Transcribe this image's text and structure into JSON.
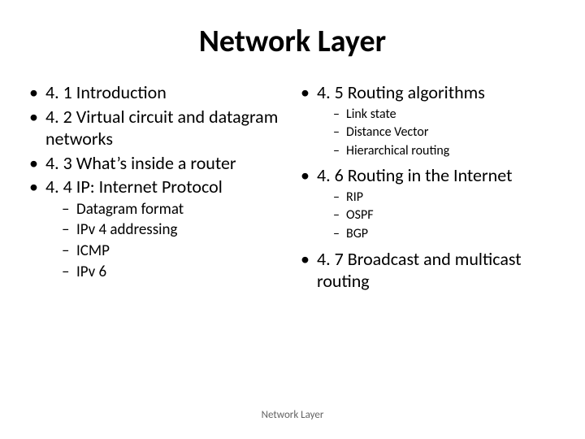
{
  "title": "Network Layer",
  "footer": "Network Layer",
  "left": {
    "items": [
      {
        "text": "4. 1 Introduction"
      },
      {
        "text": "4. 2 Virtual circuit and datagram networks"
      },
      {
        "text": "4. 3 What’s inside a router"
      },
      {
        "text": "4. 4 IP: Internet Protocol",
        "sub": [
          "Datagram format",
          "IPv 4 addressing",
          "ICMP",
          "IPv 6"
        ]
      }
    ]
  },
  "right": {
    "items": [
      {
        "text": "4. 5 Routing algorithms",
        "sub": [
          "Link state",
          "Distance Vector",
          "Hierarchical routing"
        ]
      },
      {
        "text": "4. 6 Routing in the Internet",
        "sub": [
          "RIP",
          "OSPF",
          "BGP"
        ]
      },
      {
        "text": "4. 7 Broadcast and multicast routing"
      }
    ]
  }
}
